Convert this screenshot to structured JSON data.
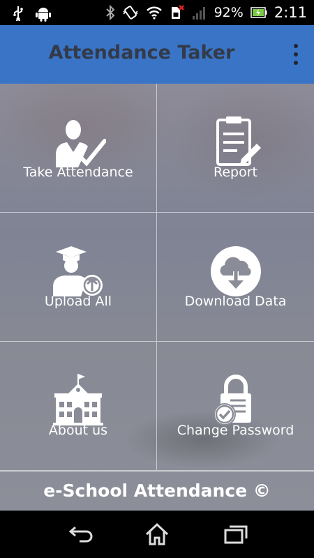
{
  "status_bar": {
    "battery_percent": "92%",
    "time": "2:11",
    "icons": [
      "usb-icon",
      "android-icon",
      "bluetooth-icon",
      "vibrate-icon",
      "wifi-icon",
      "no-sim-icon",
      "signal-icon",
      "battery-icon"
    ]
  },
  "app_bar": {
    "title": "Attendance Taker",
    "menu_icon": "overflow-menu-icon"
  },
  "menu": {
    "items": [
      {
        "label": "Take Attendance",
        "icon": "teacher-check-icon"
      },
      {
        "label": "Report",
        "icon": "clipboard-report-icon"
      },
      {
        "label": "Upload All",
        "icon": "graduate-upload-icon"
      },
      {
        "label": "Download Data",
        "icon": "cloud-download-icon"
      },
      {
        "label": "About us",
        "icon": "school-building-icon"
      },
      {
        "label": "Change Password",
        "icon": "lock-check-icon"
      }
    ]
  },
  "footer": {
    "text": "e-School Attendance ©"
  },
  "nav_bar": {
    "icons": [
      "back-icon",
      "home-icon",
      "recent-apps-icon"
    ]
  },
  "colors": {
    "app_bar": "#3a74c6",
    "title_text": "#333a48"
  }
}
